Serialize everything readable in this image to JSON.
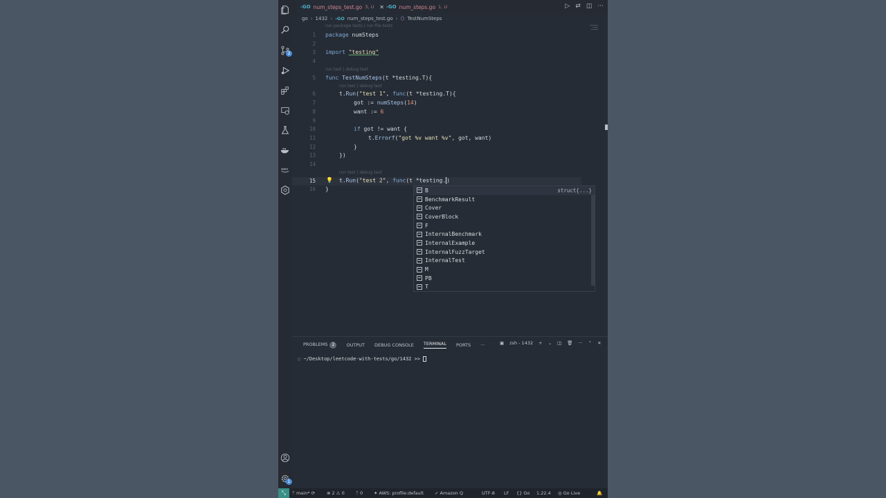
{
  "tabs": [
    {
      "icon": "go-icon",
      "label": "num_steps_test.go",
      "meta": "3, U",
      "active": true
    },
    {
      "icon": "go-icon",
      "label": "num_steps.go",
      "meta": "1, U",
      "active": false
    }
  ],
  "breadcrumb": {
    "folder1": "go",
    "folder2": "1432",
    "file": "num_steps_test.go",
    "symbol": "TestNumSteps"
  },
  "code_lens": {
    "package": "run package tests | run file tests",
    "func": "run test | debug test",
    "test1": "run test | debug test",
    "test2": "run test | debug test"
  },
  "line_numbers": [
    "1",
    "2",
    "3",
    "4",
    "5",
    "6",
    "7",
    "8",
    "9",
    "10",
    "11",
    "12",
    "13",
    "14",
    "15",
    "16"
  ],
  "code": {
    "l1_kw": "package",
    "l1_rest": " numSteps",
    "l3_kw": "import",
    "l3_str": "\"testing\"",
    "l5_kw": "func",
    "l5_fn": "TestNumSteps",
    "l5_rest": "(t *testing.T){",
    "l6_a": "t.",
    "l6_fn": "Run",
    "l6_str": "\"test 1\"",
    "l6_b": ", ",
    "l6_kw": "func",
    "l6_c": "(t *testing.T){",
    "l7_a": "got := ",
    "l7_fn": "numSteps",
    "l7_b": "(",
    "l7_num": "14",
    "l7_c": ")",
    "l8_a": "want := ",
    "l8_num": "6",
    "l10_kw": "if",
    "l10_rest": " got != want {",
    "l11_a": "t.",
    "l11_fn": "Errorf",
    "l11_b": "(",
    "l11_str": "\"got %v want %v\"",
    "l11_c": ", got, want)",
    "l12": "}",
    "l13": "})",
    "l15_a": "t.",
    "l15_fn": "Run",
    "l15_str": "\"test 2\"",
    "l15_b": ", ",
    "l15_kw": "func",
    "l15_c": "(t *testing.",
    "l15_d": ")",
    "l16": "}"
  },
  "suggestions": [
    {
      "label": "B",
      "detail": "struct{...}"
    },
    {
      "label": "BenchmarkResult"
    },
    {
      "label": "Cover"
    },
    {
      "label": "CoverBlock"
    },
    {
      "label": "F"
    },
    {
      "label": "InternalBenchmark"
    },
    {
      "label": "InternalExample"
    },
    {
      "label": "InternalFuzzTarget"
    },
    {
      "label": "InternalTest"
    },
    {
      "label": "M"
    },
    {
      "label": "PB"
    },
    {
      "label": "T"
    }
  ],
  "panel": {
    "tabs": [
      "PROBLEMS",
      "OUTPUT",
      "DEBUG CONSOLE",
      "TERMINAL",
      "PORTS"
    ],
    "problems_count": "2",
    "more": "···",
    "terminal_name": "zsh - 1432",
    "prompt": "~/Desktop/leetcode-with-tests/go/1432 >> "
  },
  "status": {
    "branch": "main*",
    "errors": "2",
    "warnings": "0",
    "ports": "0",
    "aws": "AWS: profile:default",
    "amazonq": "Amazon Q",
    "encoding": "UTF-8",
    "eol": "LF",
    "language": "Go",
    "go_version": "1.22.4",
    "golive": "Go Live"
  }
}
